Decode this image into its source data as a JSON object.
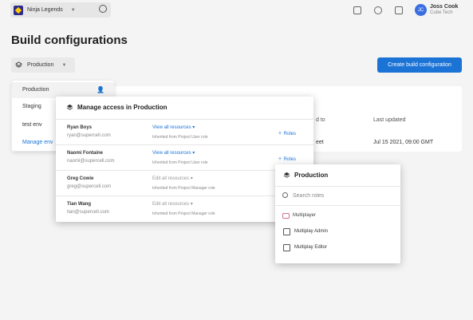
{
  "header": {
    "project_name": "Ninja Legends",
    "user_initials": "JC",
    "user_name": "Joss Cook",
    "user_org": "Cube Tech"
  },
  "page": {
    "title": "Build configurations",
    "env_selected": "Production",
    "create_button": "Create build configuration"
  },
  "table": {
    "headers": [
      "d to",
      "Last updated"
    ],
    "row": [
      "eet",
      "Jul 15 2021, 09:00 GMT"
    ]
  },
  "env_dropdown": {
    "items": [
      "Production",
      "Staging",
      "test env",
      "Manage env"
    ]
  },
  "modal": {
    "title": "Manage access in Production",
    "users": [
      {
        "name": "Ryan Boys",
        "email": "ryan@supercell.com",
        "resources": "View all resources",
        "inherited": "Inherited from Project User role",
        "roles": "Roles"
      },
      {
        "name": "Naomi Fontaine",
        "email": "naomi@supercell.com",
        "resources": "View all resources",
        "inherited": "Inherited from Project User role",
        "roles": "Roles"
      },
      {
        "name": "Greg Cowie",
        "email": "greg@supercell.com",
        "resources": "Edit all resources",
        "inherited": "Inherited from Project Manager role",
        "roles": ""
      },
      {
        "name": "Tian Wang",
        "email": "tian@supercell.com",
        "resources": "Edit all resources",
        "inherited": "Inherited from Project Manager role",
        "roles": ""
      }
    ]
  },
  "roles_popover": {
    "title": "Production",
    "search_placeholder": "Search roles",
    "category": "Multiplayer",
    "options": [
      "Multiplay Admin",
      "Multiplay Editor"
    ]
  },
  "colors": {
    "accent": "#1b73d6",
    "background": "#f4f4f4"
  }
}
